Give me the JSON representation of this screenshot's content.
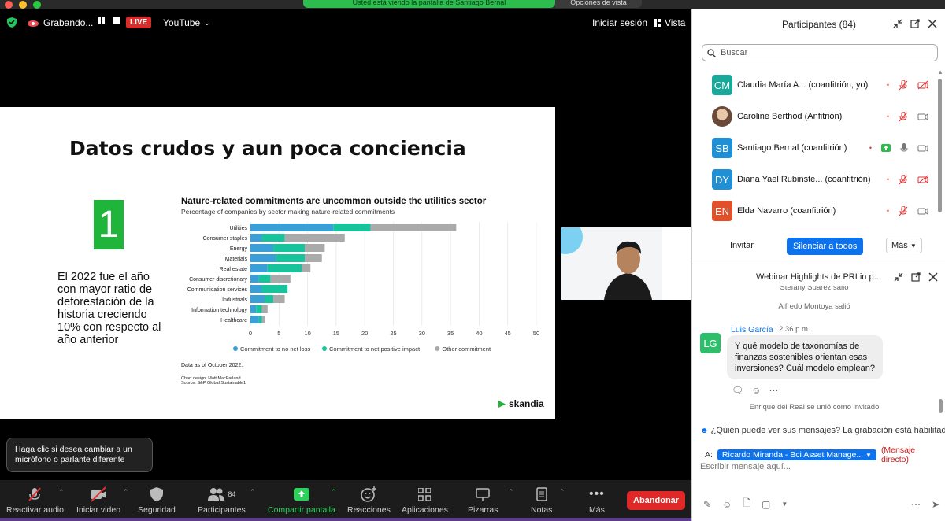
{
  "banner": {
    "text": "Usted está viendo la pantalla de Santiago Bernal",
    "options": "Opciones de vista"
  },
  "topbar": {
    "recording": "Grabando...",
    "live": "LIVE",
    "platform": "YouTube",
    "signin": "Iniciar sesión",
    "view": "Vista"
  },
  "slide": {
    "title": "Datos crudos y aun poca conciencia",
    "number": "1",
    "text": "El 2022 fue el año con mayor ratio de deforestación de la historia creciendo 10% con respecto al año anterior",
    "brand": "skandia"
  },
  "chart_data": {
    "type": "bar",
    "title": "Nature-related commitments are uncommon outside the utilities sector",
    "subtitle": "Percentage of companies by sector making nature-related commitments",
    "categories": [
      "Utilities",
      "Consumer staples",
      "Energy",
      "Materials",
      "Real estate",
      "Consumer discretionary",
      "Communication services",
      "Industrials",
      "Information technology",
      "Healthcare"
    ],
    "series": [
      {
        "name": "Commitment to no net loss",
        "color": "#3a9fd6",
        "values": [
          14.5,
          2.0,
          4.0,
          4.5,
          3.0,
          1.5,
          2.0,
          2.5,
          1.0,
          1.5
        ]
      },
      {
        "name": "Commitment to net positive impact",
        "color": "#17c39a",
        "values": [
          6.5,
          4.0,
          5.5,
          5.0,
          6.0,
          2.0,
          4.5,
          1.5,
          1.0,
          0.5
        ]
      },
      {
        "name": "Other commitment",
        "color": "#aaaaaa",
        "values": [
          15.0,
          10.5,
          3.5,
          3.0,
          1.5,
          3.5,
          0.0,
          2.0,
          1.0,
          0.5
        ]
      }
    ],
    "xticks": [
      "0",
      "5",
      "10",
      "15",
      "20",
      "25",
      "30",
      "35",
      "40",
      "45",
      "50"
    ],
    "xlim": [
      0,
      50
    ],
    "notes": [
      "Data as of October 2022.",
      "Chart design: Matt MacFarland",
      "Source: S&P Global Sustainable1"
    ]
  },
  "tooltip": "Haga clic si desea cambiar a un micrófono o parlante diferente",
  "toolbar": {
    "audio": "Reactivar audio",
    "video": "Iniciar video",
    "security": "Seguridad",
    "participants": "Participantes",
    "participants_count": "84",
    "share": "Compartir pantalla",
    "reactions": "Reacciones",
    "apps": "Aplicaciones",
    "whiteboards": "Pizarras",
    "notes": "Notas",
    "more": "Más",
    "leave": "Abandonar"
  },
  "participants_panel": {
    "title": "Participantes (84)",
    "search_placeholder": "Buscar",
    "people": [
      {
        "initials": "CM",
        "name": "Claudia María A...  (coanfitrión, yo)",
        "color": "#1aa89a"
      },
      {
        "initials": "",
        "name": "Caroline Berthod (Anfitrión)",
        "color": "#7a5a4a"
      },
      {
        "initials": "SB",
        "name": "Santiago Bernal (coanfitrión)",
        "color": "#1f8fd6"
      },
      {
        "initials": "DY",
        "name": "Diana Yael Rubinste...  (coanfitrión)",
        "color": "#1f8fd6"
      },
      {
        "initials": "EN",
        "name": "Elda Navarro (coanfitrión)",
        "color": "#e0502a"
      }
    ],
    "invite": "Invitar",
    "mute_all": "Silenciar a todos",
    "more": "Más"
  },
  "chat": {
    "title": "Webinar Highlights de PRI in p...",
    "sys1": "Stefany Suarez salió",
    "sys2": "Alfredo Montoya salió",
    "sender": "Luis García",
    "sender_initials": "LG",
    "time": "2:36 p.m.",
    "message": "Y qué modelo de taxonomías de finanzas sostenibles orientan esas inversiones? Cuál modelo emplean?",
    "sys3": "Enrique del Real se unió como invitado",
    "who_can_see": "¿Quién puede ver sus mensajes? La grabación está habilitada",
    "to_label": "A:",
    "recipient": "Ricardo Miranda - Bci Asset Manage...",
    "direct": "(Mensaje directo)",
    "input_placeholder": "Escribir mensaje aquí..."
  }
}
